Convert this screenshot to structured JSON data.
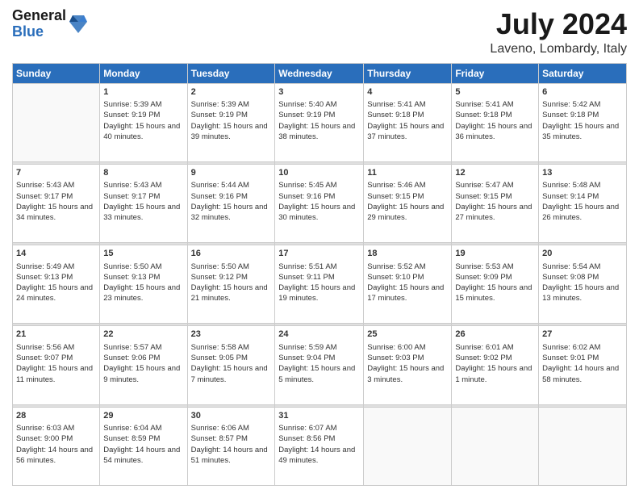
{
  "header": {
    "logo_line1": "General",
    "logo_line2": "Blue",
    "month_year": "July 2024",
    "location": "Laveno, Lombardy, Italy"
  },
  "weekdays": [
    "Sunday",
    "Monday",
    "Tuesday",
    "Wednesday",
    "Thursday",
    "Friday",
    "Saturday"
  ],
  "weeks": [
    [
      {
        "day": "",
        "sunrise": "",
        "sunset": "",
        "daylight": ""
      },
      {
        "day": "1",
        "sunrise": "Sunrise: 5:39 AM",
        "sunset": "Sunset: 9:19 PM",
        "daylight": "Daylight: 15 hours and 40 minutes."
      },
      {
        "day": "2",
        "sunrise": "Sunrise: 5:39 AM",
        "sunset": "Sunset: 9:19 PM",
        "daylight": "Daylight: 15 hours and 39 minutes."
      },
      {
        "day": "3",
        "sunrise": "Sunrise: 5:40 AM",
        "sunset": "Sunset: 9:19 PM",
        "daylight": "Daylight: 15 hours and 38 minutes."
      },
      {
        "day": "4",
        "sunrise": "Sunrise: 5:41 AM",
        "sunset": "Sunset: 9:18 PM",
        "daylight": "Daylight: 15 hours and 37 minutes."
      },
      {
        "day": "5",
        "sunrise": "Sunrise: 5:41 AM",
        "sunset": "Sunset: 9:18 PM",
        "daylight": "Daylight: 15 hours and 36 minutes."
      },
      {
        "day": "6",
        "sunrise": "Sunrise: 5:42 AM",
        "sunset": "Sunset: 9:18 PM",
        "daylight": "Daylight: 15 hours and 35 minutes."
      }
    ],
    [
      {
        "day": "7",
        "sunrise": "Sunrise: 5:43 AM",
        "sunset": "Sunset: 9:17 PM",
        "daylight": "Daylight: 15 hours and 34 minutes."
      },
      {
        "day": "8",
        "sunrise": "Sunrise: 5:43 AM",
        "sunset": "Sunset: 9:17 PM",
        "daylight": "Daylight: 15 hours and 33 minutes."
      },
      {
        "day": "9",
        "sunrise": "Sunrise: 5:44 AM",
        "sunset": "Sunset: 9:16 PM",
        "daylight": "Daylight: 15 hours and 32 minutes."
      },
      {
        "day": "10",
        "sunrise": "Sunrise: 5:45 AM",
        "sunset": "Sunset: 9:16 PM",
        "daylight": "Daylight: 15 hours and 30 minutes."
      },
      {
        "day": "11",
        "sunrise": "Sunrise: 5:46 AM",
        "sunset": "Sunset: 9:15 PM",
        "daylight": "Daylight: 15 hours and 29 minutes."
      },
      {
        "day": "12",
        "sunrise": "Sunrise: 5:47 AM",
        "sunset": "Sunset: 9:15 PM",
        "daylight": "Daylight: 15 hours and 27 minutes."
      },
      {
        "day": "13",
        "sunrise": "Sunrise: 5:48 AM",
        "sunset": "Sunset: 9:14 PM",
        "daylight": "Daylight: 15 hours and 26 minutes."
      }
    ],
    [
      {
        "day": "14",
        "sunrise": "Sunrise: 5:49 AM",
        "sunset": "Sunset: 9:13 PM",
        "daylight": "Daylight: 15 hours and 24 minutes."
      },
      {
        "day": "15",
        "sunrise": "Sunrise: 5:50 AM",
        "sunset": "Sunset: 9:13 PM",
        "daylight": "Daylight: 15 hours and 23 minutes."
      },
      {
        "day": "16",
        "sunrise": "Sunrise: 5:50 AM",
        "sunset": "Sunset: 9:12 PM",
        "daylight": "Daylight: 15 hours and 21 minutes."
      },
      {
        "day": "17",
        "sunrise": "Sunrise: 5:51 AM",
        "sunset": "Sunset: 9:11 PM",
        "daylight": "Daylight: 15 hours and 19 minutes."
      },
      {
        "day": "18",
        "sunrise": "Sunrise: 5:52 AM",
        "sunset": "Sunset: 9:10 PM",
        "daylight": "Daylight: 15 hours and 17 minutes."
      },
      {
        "day": "19",
        "sunrise": "Sunrise: 5:53 AM",
        "sunset": "Sunset: 9:09 PM",
        "daylight": "Daylight: 15 hours and 15 minutes."
      },
      {
        "day": "20",
        "sunrise": "Sunrise: 5:54 AM",
        "sunset": "Sunset: 9:08 PM",
        "daylight": "Daylight: 15 hours and 13 minutes."
      }
    ],
    [
      {
        "day": "21",
        "sunrise": "Sunrise: 5:56 AM",
        "sunset": "Sunset: 9:07 PM",
        "daylight": "Daylight: 15 hours and 11 minutes."
      },
      {
        "day": "22",
        "sunrise": "Sunrise: 5:57 AM",
        "sunset": "Sunset: 9:06 PM",
        "daylight": "Daylight: 15 hours and 9 minutes."
      },
      {
        "day": "23",
        "sunrise": "Sunrise: 5:58 AM",
        "sunset": "Sunset: 9:05 PM",
        "daylight": "Daylight: 15 hours and 7 minutes."
      },
      {
        "day": "24",
        "sunrise": "Sunrise: 5:59 AM",
        "sunset": "Sunset: 9:04 PM",
        "daylight": "Daylight: 15 hours and 5 minutes."
      },
      {
        "day": "25",
        "sunrise": "Sunrise: 6:00 AM",
        "sunset": "Sunset: 9:03 PM",
        "daylight": "Daylight: 15 hours and 3 minutes."
      },
      {
        "day": "26",
        "sunrise": "Sunrise: 6:01 AM",
        "sunset": "Sunset: 9:02 PM",
        "daylight": "Daylight: 15 hours and 1 minute."
      },
      {
        "day": "27",
        "sunrise": "Sunrise: 6:02 AM",
        "sunset": "Sunset: 9:01 PM",
        "daylight": "Daylight: 14 hours and 58 minutes."
      }
    ],
    [
      {
        "day": "28",
        "sunrise": "Sunrise: 6:03 AM",
        "sunset": "Sunset: 9:00 PM",
        "daylight": "Daylight: 14 hours and 56 minutes."
      },
      {
        "day": "29",
        "sunrise": "Sunrise: 6:04 AM",
        "sunset": "Sunset: 8:59 PM",
        "daylight": "Daylight: 14 hours and 54 minutes."
      },
      {
        "day": "30",
        "sunrise": "Sunrise: 6:06 AM",
        "sunset": "Sunset: 8:57 PM",
        "daylight": "Daylight: 14 hours and 51 minutes."
      },
      {
        "day": "31",
        "sunrise": "Sunrise: 6:07 AM",
        "sunset": "Sunset: 8:56 PM",
        "daylight": "Daylight: 14 hours and 49 minutes."
      },
      {
        "day": "",
        "sunrise": "",
        "sunset": "",
        "daylight": ""
      },
      {
        "day": "",
        "sunrise": "",
        "sunset": "",
        "daylight": ""
      },
      {
        "day": "",
        "sunrise": "",
        "sunset": "",
        "daylight": ""
      }
    ]
  ]
}
